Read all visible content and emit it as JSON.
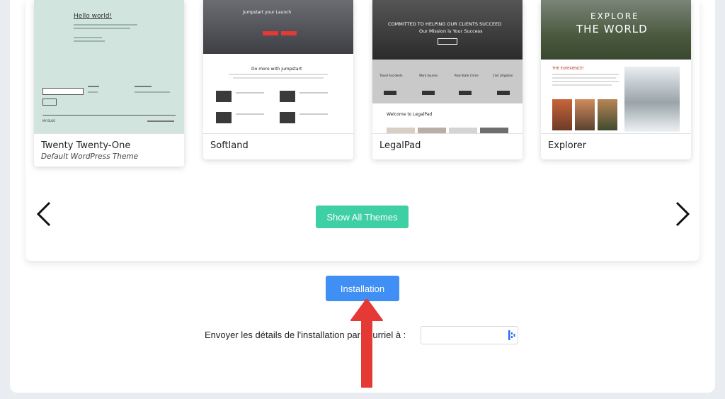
{
  "themes": [
    {
      "name": "Twenty Twenty-One",
      "subtitle": "Default WordPress Theme",
      "preview": {
        "heading": "Hello world!",
        "footer_left": "MY BLOG"
      }
    },
    {
      "name": "Softland",
      "subtitle": "",
      "preview": {
        "hero": "Jumpstart your Launch",
        "section": "Do more with jumpstart"
      }
    },
    {
      "name": "LegalPad",
      "subtitle": "",
      "preview": {
        "hero_line1": "COMMITTED TO HELPING OUR CLIENTS SUCCEED",
        "hero_line2": "Our Mission is Your Success",
        "services": [
          "Travel Accidents",
          "Work Injuries",
          "Real State Crime",
          "Civil Litigation"
        ],
        "welcome": "Welcome to LegalPad"
      }
    },
    {
      "name": "Explorer",
      "subtitle": "",
      "preview": {
        "hero_line1": "EXPLORE",
        "hero_line2": "THE WORLD",
        "section": "THE EXPERIENCE!"
      }
    }
  ],
  "actions": {
    "show_all": "Show All Themes",
    "install": "Installation",
    "email_label": "Envoyer les détails de l'installation par courriel à :"
  },
  "colors": {
    "show_all_bg": "#3ecfa4",
    "install_bg": "#3f8ff4",
    "annotation_arrow": "#e53935"
  },
  "icons": {
    "prev": "chevron-left-icon",
    "next": "chevron-right-icon",
    "password_manager": "password-manager-icon"
  }
}
